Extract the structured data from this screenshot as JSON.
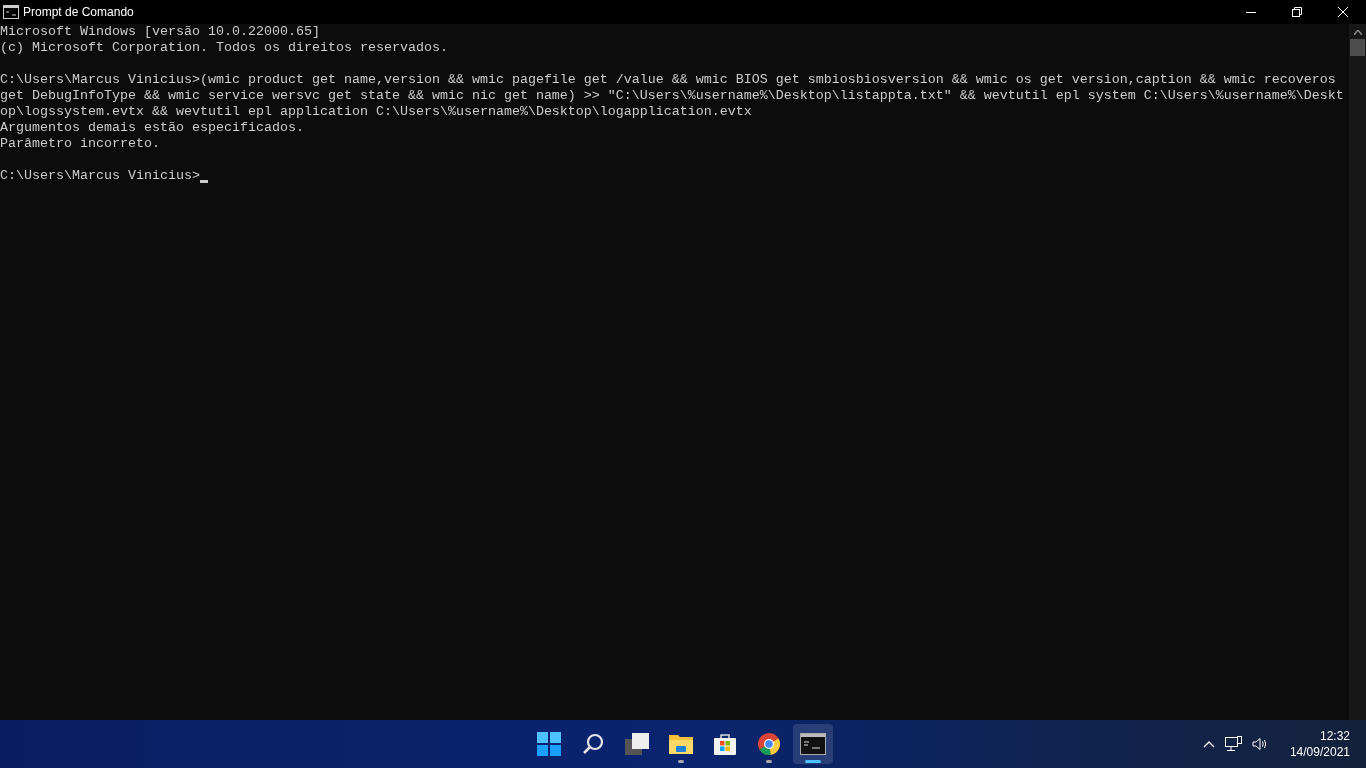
{
  "window": {
    "title": "Prompt de Comando"
  },
  "console": {
    "blocks": [
      [
        "Microsoft Windows [versão 10.0.22000.65]",
        "(c) Microsoft Corporation. Todos os direitos reservados."
      ],
      [
        "C:\\Users\\Marcus Vinicius>(wmic product get name,version && wmic pagefile get /value && wmic BIOS get smbiosbiosversion && wmic os get version,caption && wmic recoveros",
        "get DebugInfoType && wmic service wersvc get state && wmic nic get name) >> \"C:\\Users\\%username%\\Desktop\\listappta.txt\" && wevtutil epl system C:\\Users\\%username%\\Deskt",
        "op\\logssystem.evtx && wevtutil epl application C:\\Users\\%username%\\Desktop\\logapplication.evtx",
        "Argumentos demais estão especificados.",
        "Parâmetro incorreto."
      ],
      [
        "C:\\Users\\Marcus Vinicius>"
      ]
    ],
    "cursor": true
  },
  "taskbar": {
    "apps": [
      {
        "kind": "start",
        "open": false,
        "selected": false
      },
      {
        "kind": "search",
        "open": false,
        "selected": false
      },
      {
        "kind": "taskview",
        "open": false,
        "selected": false
      },
      {
        "kind": "explorer",
        "open": true,
        "selected": false
      },
      {
        "kind": "store",
        "open": false,
        "selected": false
      },
      {
        "kind": "browser",
        "open": true,
        "selected": false
      },
      {
        "kind": "terminal",
        "open": true,
        "selected": true
      }
    ],
    "time": "12:32",
    "date": "14/09/2021"
  }
}
